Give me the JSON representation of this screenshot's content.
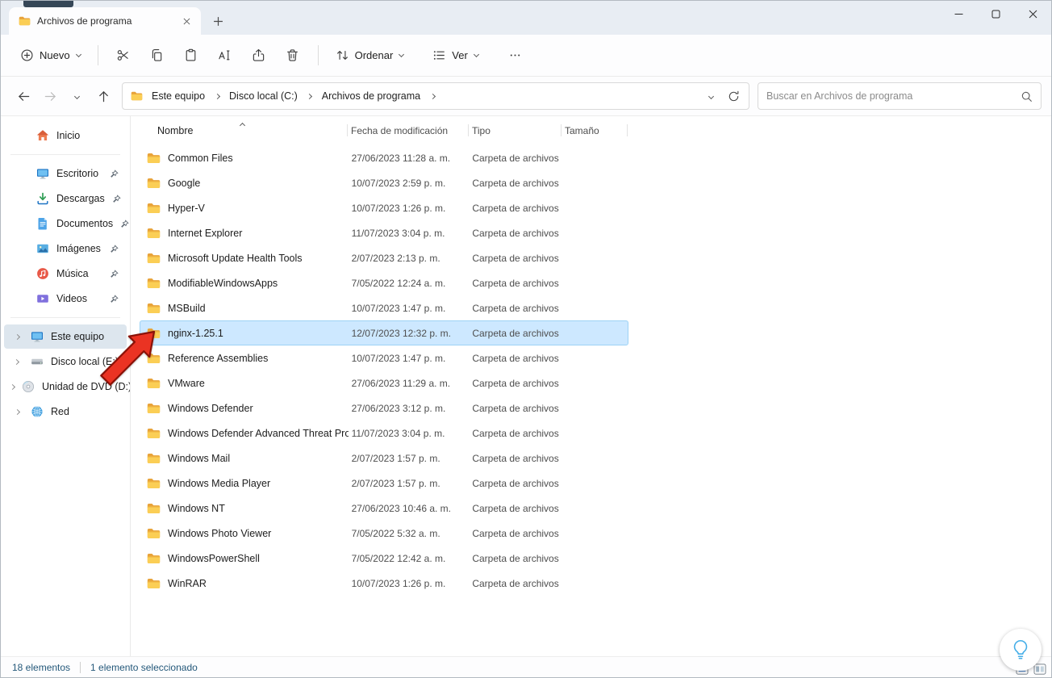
{
  "window": {
    "tab_title": "Archivos de programa"
  },
  "toolbar": {
    "new_label": "Nuevo",
    "sort_label": "Ordenar",
    "view_label": "Ver"
  },
  "address": {
    "breadcrumbs": [
      "Este equipo",
      "Disco local (C:)",
      "Archivos de programa"
    ],
    "search_placeholder": "Buscar en Archivos de programa"
  },
  "sidebar": {
    "home_label": "Inicio",
    "pinned": [
      {
        "id": "escritorio",
        "label": "Escritorio",
        "icon": "desktop",
        "pinned": true
      },
      {
        "id": "descargas",
        "label": "Descargas",
        "icon": "downloads",
        "pinned": true
      },
      {
        "id": "documentos",
        "label": "Documentos",
        "icon": "documents",
        "pinned": true
      },
      {
        "id": "imagenes",
        "label": "Imágenes",
        "icon": "pictures",
        "pinned": true
      },
      {
        "id": "musica",
        "label": "Música",
        "icon": "music",
        "pinned": true
      },
      {
        "id": "videos",
        "label": "Videos",
        "icon": "videos",
        "pinned": true
      }
    ],
    "tree": [
      {
        "id": "este-equipo",
        "label": "Este equipo",
        "icon": "computer",
        "selected": true
      },
      {
        "id": "disco-local-e",
        "label": "Disco local (E:)",
        "icon": "disk",
        "selected": false
      },
      {
        "id": "unidad-dvd-d",
        "label": "Unidad de DVD (D:)",
        "icon": "dvd",
        "selected": false
      },
      {
        "id": "red",
        "label": "Red",
        "icon": "network",
        "selected": false
      }
    ]
  },
  "file_list": {
    "columns": [
      "Nombre",
      "Fecha de modificación",
      "Tipo",
      "Tamaño"
    ],
    "sorted_by": "Nombre",
    "selected": "nginx-1.25.1",
    "rows": [
      {
        "name": "Common Files",
        "modified": "27/06/2023 11:28 a. m.",
        "type": "Carpeta de archivos",
        "size": ""
      },
      {
        "name": "Google",
        "modified": "10/07/2023 2:59 p. m.",
        "type": "Carpeta de archivos",
        "size": ""
      },
      {
        "name": "Hyper-V",
        "modified": "10/07/2023 1:26 p. m.",
        "type": "Carpeta de archivos",
        "size": ""
      },
      {
        "name": "Internet Explorer",
        "modified": "11/07/2023 3:04 p. m.",
        "type": "Carpeta de archivos",
        "size": ""
      },
      {
        "name": "Microsoft Update Health Tools",
        "modified": "2/07/2023 2:13 p. m.",
        "type": "Carpeta de archivos",
        "size": ""
      },
      {
        "name": "ModifiableWindowsApps",
        "modified": "7/05/2022 12:24 a. m.",
        "type": "Carpeta de archivos",
        "size": ""
      },
      {
        "name": "MSBuild",
        "modified": "10/07/2023 1:47 p. m.",
        "type": "Carpeta de archivos",
        "size": ""
      },
      {
        "name": "nginx-1.25.1",
        "modified": "12/07/2023 12:32 p. m.",
        "type": "Carpeta de archivos",
        "size": ""
      },
      {
        "name": "Reference Assemblies",
        "modified": "10/07/2023 1:47 p. m.",
        "type": "Carpeta de archivos",
        "size": ""
      },
      {
        "name": "VMware",
        "modified": "27/06/2023 11:29 a. m.",
        "type": "Carpeta de archivos",
        "size": ""
      },
      {
        "name": "Windows Defender",
        "modified": "27/06/2023 3:12 p. m.",
        "type": "Carpeta de archivos",
        "size": ""
      },
      {
        "name": "Windows Defender Advanced Threat Prot...",
        "modified": "11/07/2023 3:04 p. m.",
        "type": "Carpeta de archivos",
        "size": ""
      },
      {
        "name": "Windows Mail",
        "modified": "2/07/2023 1:57 p. m.",
        "type": "Carpeta de archivos",
        "size": ""
      },
      {
        "name": "Windows Media Player",
        "modified": "2/07/2023 1:57 p. m.",
        "type": "Carpeta de archivos",
        "size": ""
      },
      {
        "name": "Windows NT",
        "modified": "27/06/2023 10:46 a. m.",
        "type": "Carpeta de archivos",
        "size": ""
      },
      {
        "name": "Windows Photo Viewer",
        "modified": "7/05/2022 5:32 a. m.",
        "type": "Carpeta de archivos",
        "size": ""
      },
      {
        "name": "WindowsPowerShell",
        "modified": "7/05/2022 12:42 a. m.",
        "type": "Carpeta de archivos",
        "size": ""
      },
      {
        "name": "WinRAR",
        "modified": "10/07/2023 1:26 p. m.",
        "type": "Carpeta de archivos",
        "size": ""
      }
    ]
  },
  "status_bar": {
    "items_count": "18 elementos",
    "selection_count": "1 elemento seleccionado"
  },
  "colors": {
    "selection_bg": "#cde8ff",
    "selection_border": "#9cd2f5",
    "titlebar_bg": "#e8edf3",
    "annotation_arrow_red": "#ea3323"
  }
}
